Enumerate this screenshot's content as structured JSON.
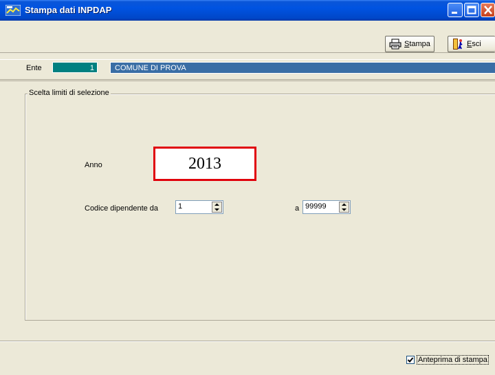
{
  "window": {
    "title": "Stampa dati INPDAP"
  },
  "toolbar": {
    "stampa": {
      "mnemonic": "S",
      "rest": "tampa"
    },
    "esci": {
      "mnemonic": "E",
      "rest": "sci"
    }
  },
  "ente": {
    "label": "Ente",
    "code": "1",
    "name": "COMUNE DI PROVA"
  },
  "selection": {
    "group_title": "Scelta limiti di selezione",
    "anno_label": "Anno",
    "anno_value": "2013",
    "codice_label": "Codice dipendente da",
    "codice_from": "1",
    "a_label": "a",
    "codice_to": "99999"
  },
  "footer": {
    "preview_label": "Anteprima di stampa",
    "preview_checked": true
  },
  "colors": {
    "accent": "#e0000b",
    "title_bar": "#0053e1",
    "ente_code_bg": "#008080",
    "ente_name_bg": "#3a6ea5"
  }
}
